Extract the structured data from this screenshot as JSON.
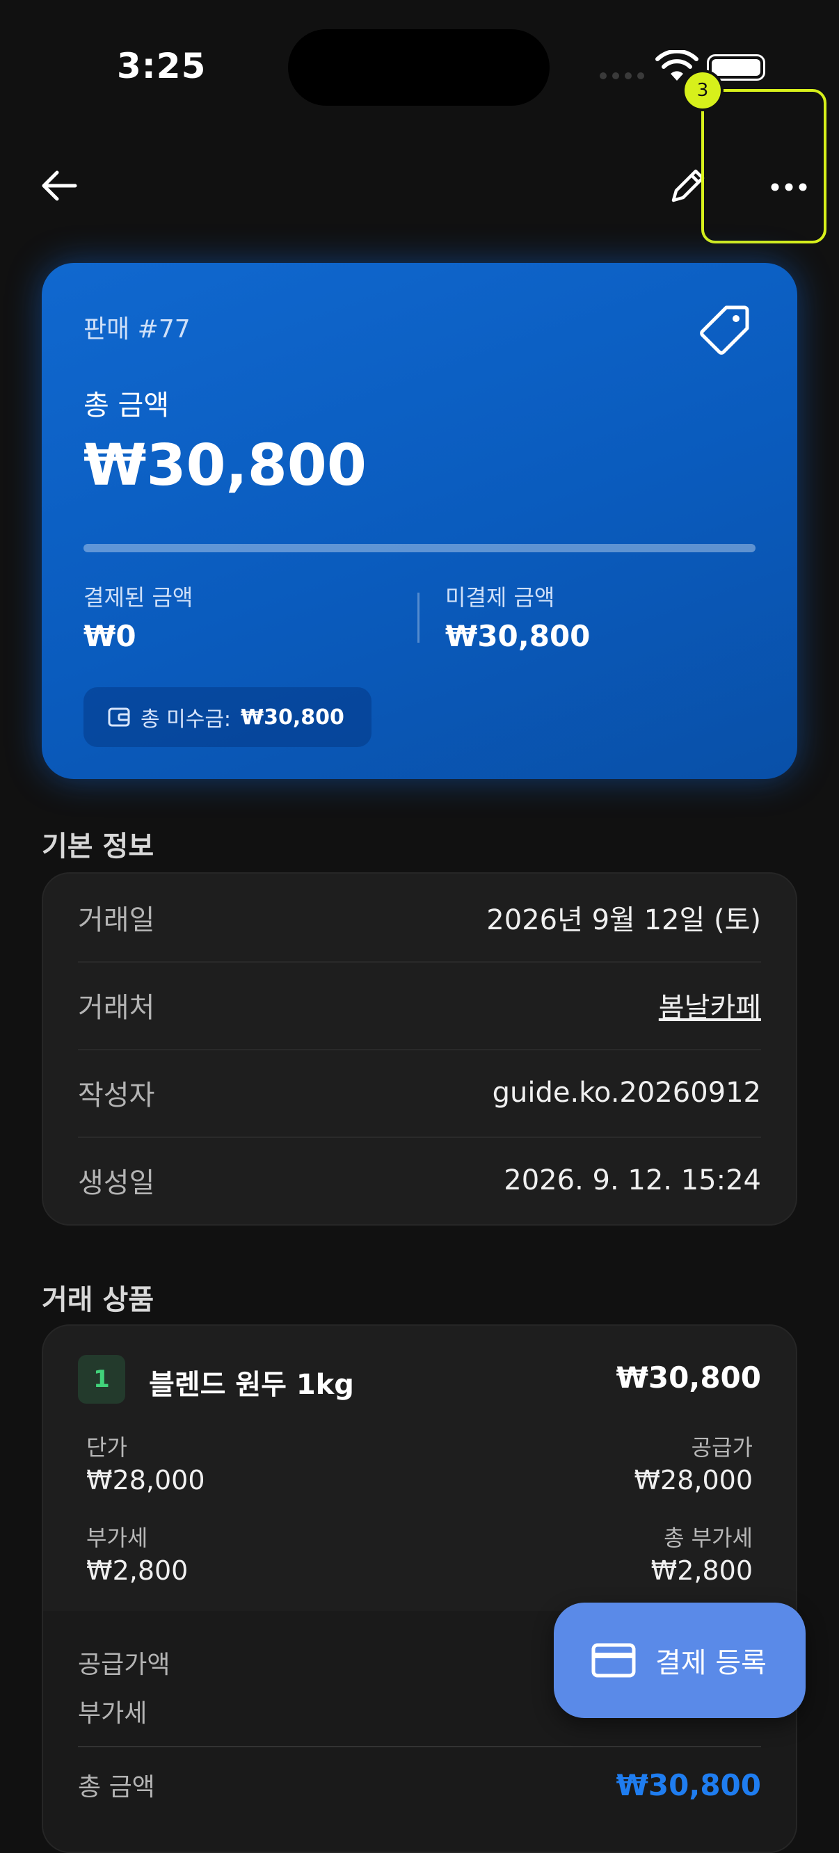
{
  "status_bar": {
    "time": "3:25"
  },
  "annotation": {
    "badge_number": "3",
    "highlight_color": "#d7f01b"
  },
  "header": {
    "back_icon": "arrow-left-icon",
    "edit_icon": "pencil-icon",
    "more_icon": "ellipsis-icon"
  },
  "summary_card": {
    "sale_number": "판매 #77",
    "total_label": "총 금액",
    "total_amount": "₩30,800",
    "paid_fraction": 0,
    "paid_label": "결제된 금액",
    "paid_value": "₩0",
    "unpaid_label": "미결제 금액",
    "unpaid_value": "₩30,800",
    "receivable_label": "총 미수금:",
    "receivable_value": "₩30,800",
    "accent": "#0a5bbd"
  },
  "basic_info": {
    "title": "기본 정보",
    "rows": [
      {
        "label": "거래일",
        "value": "2026년 9월 12일 (토)"
      },
      {
        "label": "거래처",
        "value": "봄날카페"
      },
      {
        "label": "작성자",
        "value": "guide.ko.20260912"
      },
      {
        "label": "생성일",
        "value": "2026. 9. 12. 15:24"
      }
    ]
  },
  "products": {
    "title": "거래 상품",
    "items": [
      {
        "index": "1",
        "name": "블렌드 원두 1kg",
        "total": "₩30,800",
        "unit_price_label": "단가",
        "unit_price": "₩28,000",
        "supply_price_label": "공급가",
        "supply_price": "₩28,000",
        "vat_label": "부가세",
        "vat": "₩2,800",
        "total_vat_label": "총 부가세",
        "total_vat": "₩2,800"
      }
    ],
    "summary": {
      "supply_total_label": "공급가액",
      "vat_label": "부가세",
      "grand_total_label": "총 금액",
      "grand_total": "₩30,800"
    }
  },
  "fab": {
    "label": "결제 등록",
    "icon": "credit-card-icon",
    "color": "#5a8ae8"
  }
}
